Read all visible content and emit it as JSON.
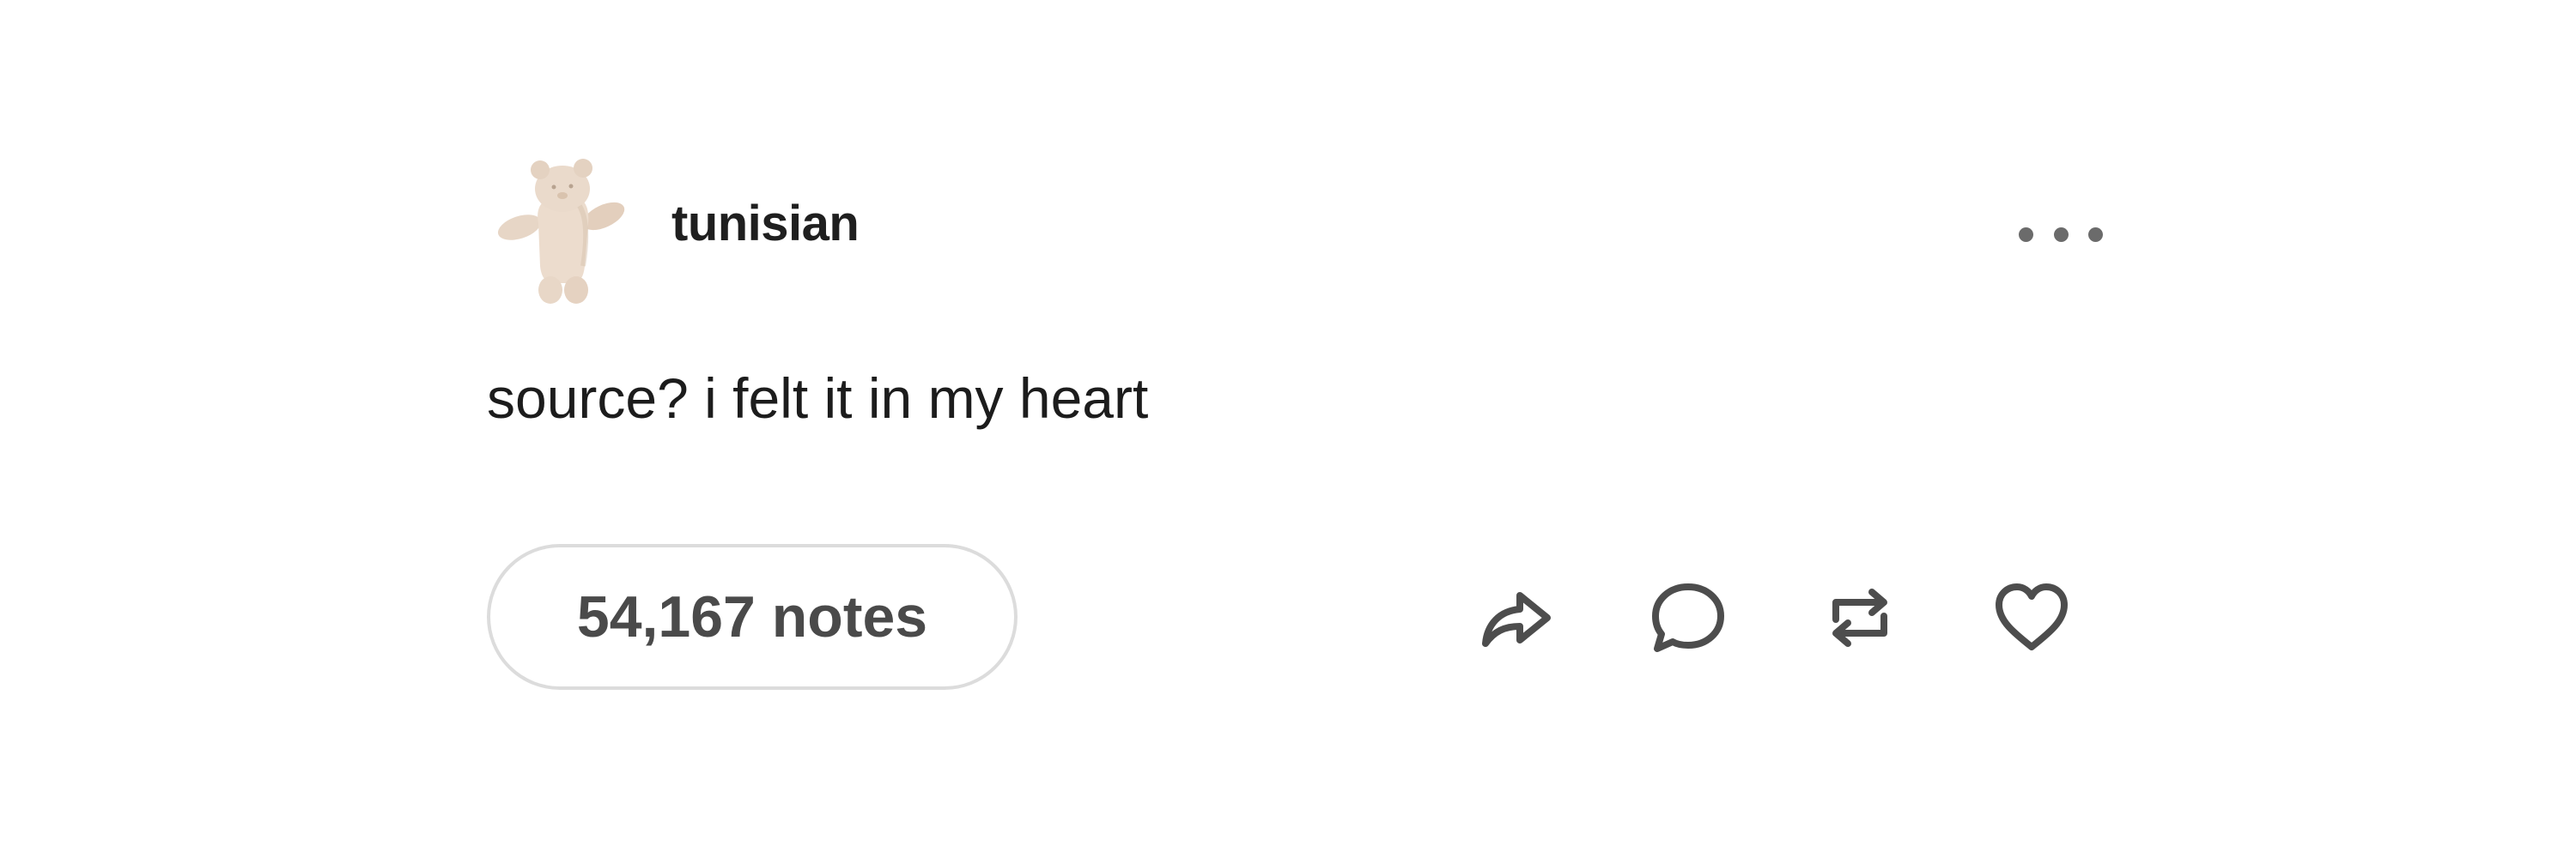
{
  "post": {
    "username": "tunisian",
    "text": "source? i felt it in my heart",
    "notes_label": "54,167 notes"
  },
  "icons": {
    "avatar": "teddy-bear-avatar",
    "more": "more-options-icon",
    "share": "share-icon",
    "reply": "reply-icon",
    "reblog": "reblog-icon",
    "like": "heart-icon"
  },
  "colors": {
    "text": "#1c1c1c",
    "icon": "#4d4d4d",
    "pill_border": "#dcdcdc",
    "background": "#ffffff"
  }
}
